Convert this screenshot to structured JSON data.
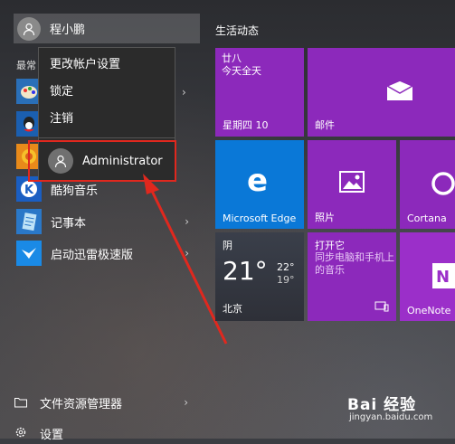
{
  "user": {
    "name": "程小鹏"
  },
  "most_used_label": "最常",
  "menu": {
    "items": [
      "更改帐户设置",
      "锁定",
      "注销"
    ],
    "switch_user": "Administrator"
  },
  "apps": [
    {
      "label": "",
      "icon": "paint-icon"
    },
    {
      "label": "",
      "icon": "qq-icon"
    },
    {
      "label": "",
      "icon": "browser-icon"
    },
    {
      "label": "酷狗音乐",
      "icon": "kugou-icon"
    },
    {
      "label": "记事本",
      "icon": "notepad-icon"
    },
    {
      "label": "启动迅雷极速版",
      "icon": "xunlei-icon"
    }
  ],
  "bottom": {
    "explorer": "文件资源管理器",
    "settings": "设置"
  },
  "tiles": {
    "group_title": "生活动态",
    "calendar": {
      "lunar": "廿八",
      "desc": "今天全天",
      "date": "星期四 10"
    },
    "mail": "邮件",
    "edge": "Microsoft Edge",
    "photos": "照片",
    "cortana": "Cortana",
    "weather": {
      "condition": "阴",
      "temp": "21°",
      "high": "22°",
      "low": "19°",
      "city": "北京"
    },
    "music": {
      "title": "打开它",
      "subtitle": "同步电脑和手机上的音乐"
    },
    "onenote": "OneNote"
  },
  "watermark": {
    "logo": "Bai 经验",
    "url": "jingyan.baidu.com"
  },
  "colors": {
    "purple": "#8c29bb",
    "blue": "#0a78d7",
    "highlight": "#e0281e"
  }
}
